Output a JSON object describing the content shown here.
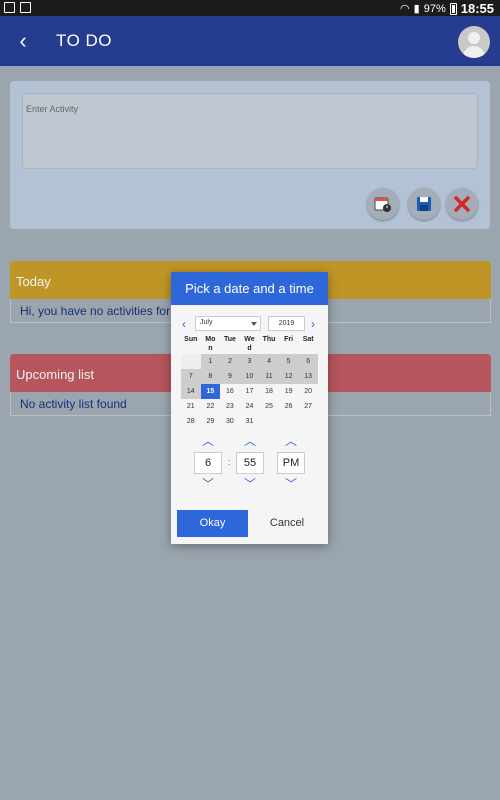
{
  "status": {
    "battery": "97%",
    "time": "18:55"
  },
  "appbar": {
    "title": "TO DO"
  },
  "entry": {
    "placeholder": "Enter Activity"
  },
  "today": {
    "header": "Today",
    "message": "Hi, you have no activities for To"
  },
  "upcoming": {
    "header": "Upcoming list",
    "message": "No activity list found"
  },
  "dialog": {
    "title": "Pick a date and a time",
    "month": "July",
    "year": "2019",
    "weekdays": [
      "Sun",
      "Mo\nn",
      "Tue",
      "We\nd",
      "Thu",
      "Fri",
      "Sat"
    ],
    "weeks": [
      [
        "",
        "1",
        "2",
        "3",
        "4",
        "5",
        "6"
      ],
      [
        "7",
        "8",
        "9",
        "10",
        "11",
        "12",
        "13"
      ],
      [
        "14",
        "15",
        "16",
        "17",
        "18",
        "19",
        "20"
      ],
      [
        "21",
        "22",
        "23",
        "24",
        "25",
        "26",
        "27"
      ],
      [
        "28",
        "29",
        "30",
        "31",
        "",
        "",
        ""
      ]
    ],
    "selected_day": "15",
    "time": {
      "hour": "6",
      "minute": "55",
      "ampm": "PM",
      "separator": ":"
    },
    "ok_label": "Okay",
    "cancel_label": "Cancel"
  },
  "colors": {
    "appbar": "#263d8f",
    "accent": "#2d67d9",
    "today_header": "#bf9626",
    "upcoming_header": "#b5555c"
  }
}
